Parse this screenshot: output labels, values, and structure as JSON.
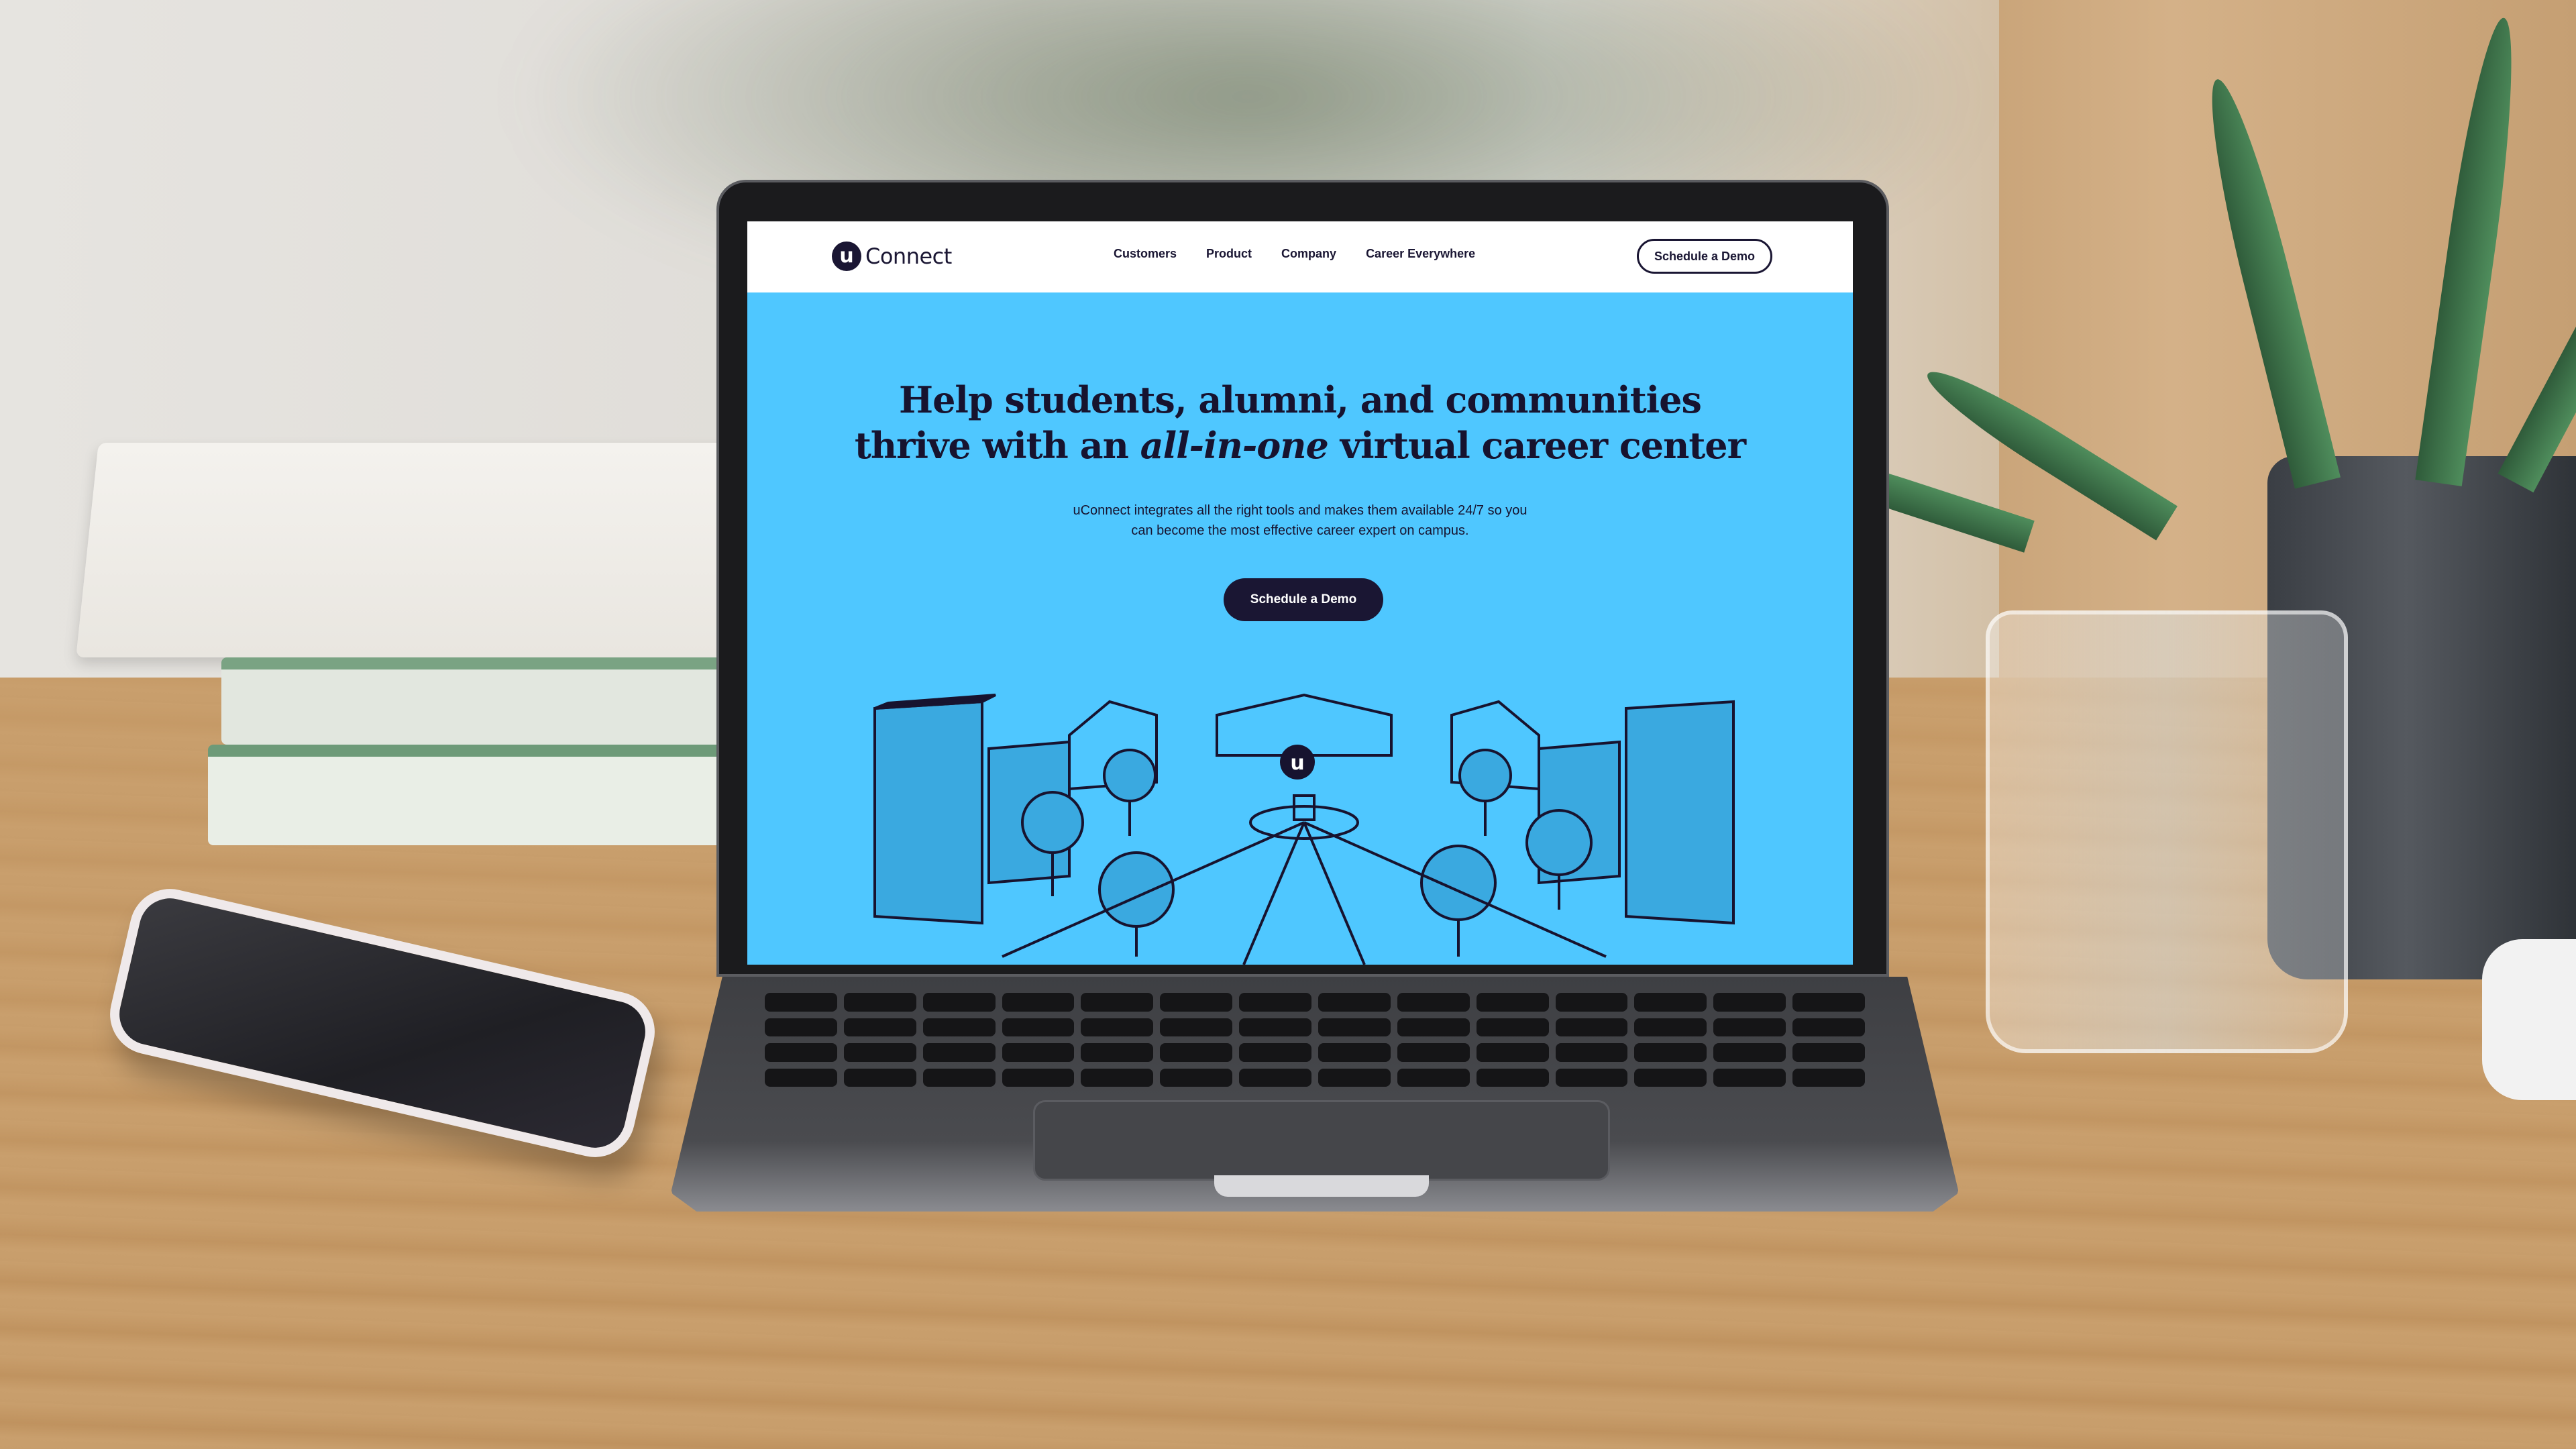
{
  "app": {
    "brand_mark": "u",
    "brand_name": "Connect"
  },
  "nav": {
    "links": [
      {
        "label": "Customers"
      },
      {
        "label": "Product"
      },
      {
        "label": "Company"
      },
      {
        "label": "Career Everywhere"
      }
    ],
    "cta_label": "Schedule a Demo"
  },
  "hero": {
    "title_line1": "Help students, alumni, and communities",
    "title_line2_pre": "thrive with an ",
    "title_line2_em": "all-in-one",
    "title_line2_post": " virtual career center",
    "subtitle_line1": "uConnect integrates all the right tools and makes them available 24/7 so you",
    "subtitle_line2": "can become the most effective career expert on campus.",
    "cta_label": "Schedule a Demo",
    "illustration_mark": "u"
  },
  "colors": {
    "hero_bg": "#4fc7ff",
    "ink": "#1a1633",
    "nav_bg": "#ffffff"
  },
  "icons": {
    "logo": "u-circle-logo",
    "illustration": "campus-city-illustration"
  }
}
